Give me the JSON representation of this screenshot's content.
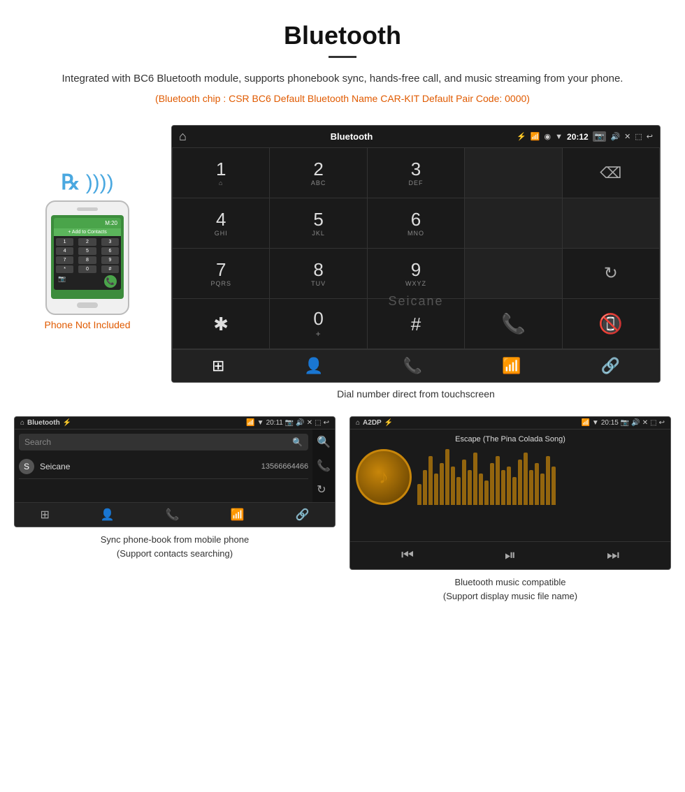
{
  "page": {
    "title": "Bluetooth",
    "description": "Integrated with BC6 Bluetooth module, supports phonebook sync, hands-free call, and music streaming from your phone.",
    "specs": "(Bluetooth chip : CSR BC6    Default Bluetooth Name CAR-KIT    Default Pair Code: 0000)",
    "divider": true
  },
  "phone_mock": {
    "not_included_label": "Phone Not Included",
    "bt_symbol": "ʙ",
    "add_to_contacts": "+ Add to Contacts"
  },
  "main_screen": {
    "status_bar": {
      "title": "Bluetooth",
      "time": "20:12",
      "icons": [
        "home",
        "usb",
        "bluetooth",
        "location",
        "wifi",
        "camera",
        "volume",
        "close",
        "fullscreen",
        "back"
      ]
    },
    "dialpad": {
      "keys": [
        {
          "num": "1",
          "sub": "⌂"
        },
        {
          "num": "2",
          "sub": "ABC"
        },
        {
          "num": "3",
          "sub": "DEF"
        },
        {
          "num": "",
          "sub": ""
        },
        {
          "num": "⌫",
          "sub": ""
        },
        {
          "num": "4",
          "sub": "GHI"
        },
        {
          "num": "5",
          "sub": "JKL"
        },
        {
          "num": "6",
          "sub": "MNO"
        },
        {
          "num": "",
          "sub": ""
        },
        {
          "num": "",
          "sub": ""
        },
        {
          "num": "7",
          "sub": "PQRS"
        },
        {
          "num": "8",
          "sub": "TUV"
        },
        {
          "num": "9",
          "sub": "WXYZ"
        },
        {
          "num": "",
          "sub": ""
        },
        {
          "num": "↻",
          "sub": ""
        },
        {
          "num": "✱",
          "sub": ""
        },
        {
          "num": "0",
          "sub": "+"
        },
        {
          "num": "#",
          "sub": ""
        },
        {
          "num": "📞",
          "sub": ""
        },
        {
          "num": "📵",
          "sub": ""
        }
      ]
    },
    "bottom_nav": {
      "icons": [
        "grid",
        "person",
        "phone",
        "bluetooth",
        "link"
      ]
    },
    "caption": "Dial number direct from touchscreen",
    "watermark": "Seicane"
  },
  "phonebook_screen": {
    "status_bar": {
      "title": "Bluetooth",
      "time": "20:11"
    },
    "search_placeholder": "Search",
    "contacts": [
      {
        "letter": "S",
        "name": "Seicane",
        "number": "13566664466"
      }
    ],
    "bottom_nav_icons": [
      "grid",
      "person",
      "phone",
      "bluetooth",
      "link"
    ],
    "caption_line1": "Sync phone-book from mobile phone",
    "caption_line2": "(Support contacts searching)"
  },
  "music_screen": {
    "status_bar": {
      "title": "A2DP",
      "time": "20:15"
    },
    "song_title": "Escape (The Pina Colada Song)",
    "controls": [
      "prev",
      "play-pause",
      "next"
    ],
    "caption_line1": "Bluetooth music compatible",
    "caption_line2": "(Support display music file name)",
    "eq_bars": [
      30,
      50,
      70,
      45,
      60,
      80,
      55,
      40,
      65,
      50,
      75,
      45,
      35,
      60,
      70,
      50,
      55,
      40,
      65,
      75,
      50,
      60,
      45,
      70,
      55
    ]
  },
  "colors": {
    "accent_orange": "#e05a00",
    "accent_green": "#4caf50",
    "accent_red": "#e53935",
    "bt_blue": "#4aa8e0",
    "screen_bg": "#1a1a1a",
    "text_primary": "#ddd",
    "text_secondary": "#888"
  }
}
